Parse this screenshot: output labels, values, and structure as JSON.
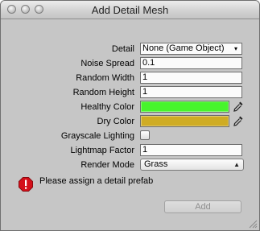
{
  "window": {
    "title": "Add Detail Mesh"
  },
  "form": {
    "detail": {
      "label": "Detail",
      "value": "None (Game Object)",
      "icon": "object-picker-dot-icon"
    },
    "noise_spread": {
      "label": "Noise Spread",
      "value": "0.1"
    },
    "random_width": {
      "label": "Random Width",
      "value": "1"
    },
    "random_height": {
      "label": "Random Height",
      "value": "1"
    },
    "healthy_color": {
      "label": "Healthy Color",
      "color": "#47f42c",
      "icon": "eyedropper-icon"
    },
    "dry_color": {
      "label": "Dry Color",
      "color": "#cfac24",
      "icon": "eyedropper-icon"
    },
    "grayscale_lighting": {
      "label": "Grayscale Lighting",
      "checked": false
    },
    "lightmap_factor": {
      "label": "Lightmap Factor",
      "value": "1"
    },
    "render_mode": {
      "label": "Render Mode",
      "value": "Grass",
      "icon": "updown-arrows-icon"
    }
  },
  "message": {
    "icon": "error-icon",
    "text": "Please assign a detail prefab",
    "color": "#d4101a"
  },
  "buttons": {
    "add_label": "Add"
  }
}
